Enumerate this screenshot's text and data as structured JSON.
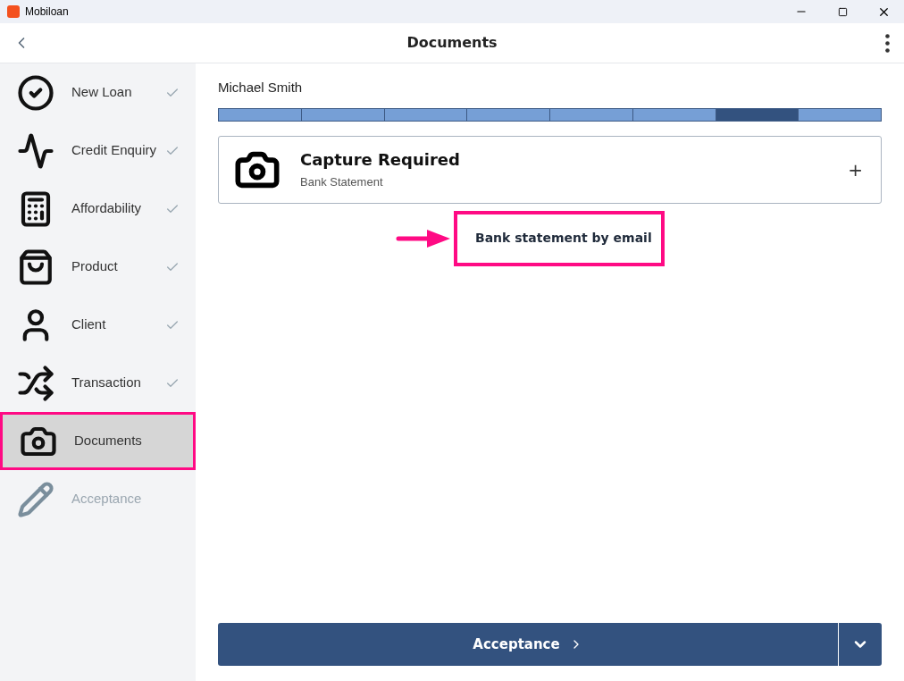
{
  "window": {
    "title": "Mobiloan"
  },
  "header": {
    "title": "Documents"
  },
  "sidebar": {
    "items": [
      {
        "kind": "new-loan",
        "label": "New Loan",
        "done": true,
        "selected": false,
        "disabled": false
      },
      {
        "kind": "credit",
        "label": "Credit Enquiry",
        "done": true,
        "selected": false,
        "disabled": false
      },
      {
        "kind": "affordability",
        "label": "Affordability",
        "done": true,
        "selected": false,
        "disabled": false
      },
      {
        "kind": "product",
        "label": "Product",
        "done": true,
        "selected": false,
        "disabled": false
      },
      {
        "kind": "client",
        "label": "Client",
        "done": true,
        "selected": false,
        "disabled": false
      },
      {
        "kind": "transaction",
        "label": "Transaction",
        "done": true,
        "selected": false,
        "disabled": false
      },
      {
        "kind": "documents",
        "label": "Documents",
        "done": false,
        "selected": true,
        "disabled": false
      },
      {
        "kind": "acceptance",
        "label": "Acceptance",
        "done": false,
        "selected": false,
        "disabled": true
      }
    ]
  },
  "client_name": "Michael Smith",
  "progress": [
    {
      "selected": false
    },
    {
      "selected": false
    },
    {
      "selected": false
    },
    {
      "selected": false
    },
    {
      "selected": false
    },
    {
      "selected": false
    },
    {
      "selected": true
    },
    {
      "selected": false
    }
  ],
  "capture_card": {
    "title": "Capture Required",
    "subtitle": "Bank Statement",
    "action": "+"
  },
  "menu_option": {
    "label": "Bank statement by email"
  },
  "footer_button": {
    "label": "Acceptance"
  }
}
